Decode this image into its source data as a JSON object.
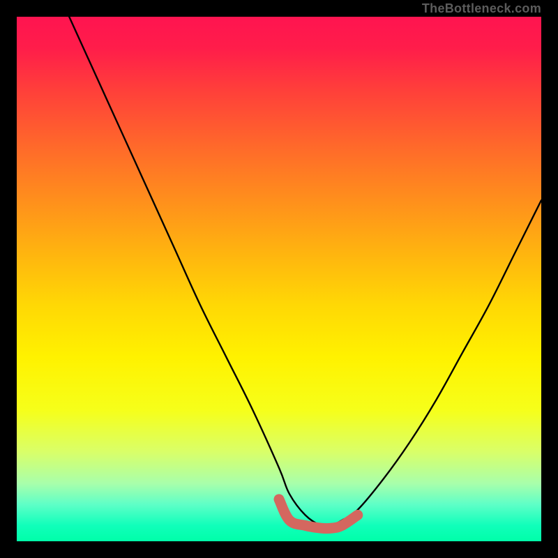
{
  "credit": "TheBottleneck.com",
  "colors": {
    "curve": "#000000",
    "highlight": "#d4675f",
    "frame_bg": "#000000"
  },
  "chart_data": {
    "type": "line",
    "title": "",
    "xlabel": "",
    "ylabel": "",
    "xlim": [
      0,
      100
    ],
    "ylim": [
      0,
      100
    ],
    "grid": false,
    "legend": false,
    "annotations": [
      {
        "text": "TheBottleneck.com",
        "position": "top-right"
      }
    ],
    "series": [
      {
        "name": "bottleneck-curve",
        "color": "#000000",
        "x": [
          10,
          15,
          20,
          25,
          30,
          35,
          40,
          45,
          50,
          52,
          55,
          58,
          60,
          62,
          65,
          70,
          75,
          80,
          85,
          90,
          95,
          100
        ],
        "values": [
          100,
          89,
          78,
          67,
          56,
          45,
          35,
          25,
          14,
          9,
          5,
          3,
          3,
          4,
          6,
          12,
          19,
          27,
          36,
          45,
          55,
          65
        ]
      },
      {
        "name": "optimal-range-highlight",
        "color": "#d4675f",
        "x": [
          50,
          52,
          55,
          58,
          60,
          62,
          65
        ],
        "values": [
          8,
          4,
          3,
          2.5,
          2.5,
          3,
          5
        ]
      }
    ]
  }
}
